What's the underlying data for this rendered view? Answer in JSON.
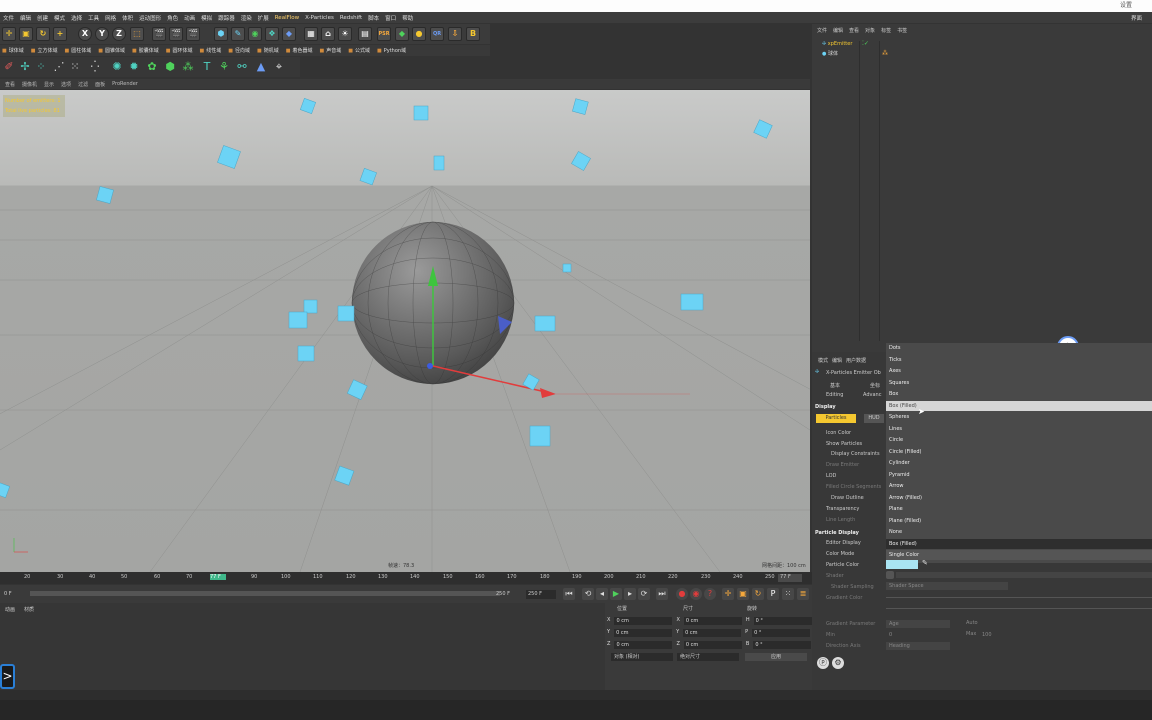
{
  "window": {
    "title": "设置"
  },
  "menubar": {
    "items": [
      "文件",
      "编辑",
      "创建",
      "模式",
      "选择",
      "工具",
      "网格",
      "体积",
      "运动图形",
      "角色",
      "动画",
      "模拟",
      "跟踪器",
      "渲染",
      "扩展",
      "窗口",
      "帮助"
    ],
    "highlight": "RealFlow",
    "extra": [
      "X-Particles",
      "Redshift",
      "脚本",
      "窗口",
      "帮助"
    ],
    "right": "界面"
  },
  "toolbar2": {
    "items": [
      "球体域",
      "立方体域",
      "圆柱体域",
      "圆锥体域",
      "胶囊体域",
      "圆环体域",
      "线性域",
      "径向域",
      "随机域",
      "着色器域",
      "声音域",
      "公式域",
      "Python域"
    ]
  },
  "viewport_menu": [
    "查看",
    "摄像机",
    "显示",
    "选项",
    "过滤",
    "面板",
    "ProRender"
  ],
  "hud": {
    "line1": "Number of emitters: 1",
    "line2": "Total live particles: 81"
  },
  "viewport_footer": {
    "speed": "帧速：78.3",
    "grid": "网格间距：100 cm"
  },
  "timeline": {
    "ticks": [
      "20",
      "30",
      "40",
      "50",
      "60",
      "70",
      "77 F",
      "90",
      "100",
      "110",
      "120",
      "130",
      "140",
      "150",
      "160",
      "170",
      "180",
      "190",
      "200",
      "210",
      "220",
      "230",
      "240",
      "250"
    ],
    "current_frame": "77 F",
    "end": "250 F"
  },
  "transport": {
    "start": "0 F",
    "end_field": "250 F",
    "end_field2": "250 F"
  },
  "bottom_left": {
    "tabs": [
      "动画",
      "材质"
    ]
  },
  "coords": {
    "headers": [
      "位置",
      "尺寸",
      "旋转"
    ],
    "rows": [
      {
        "axis": "X",
        "pos": "0 cm",
        "size_axis": "X",
        "size": "0 cm",
        "rot_axis": "H",
        "rot": "0 °"
      },
      {
        "axis": "Y",
        "pos": "0 cm",
        "size_axis": "Y",
        "size": "0 cm",
        "rot_axis": "P",
        "rot": "0 °"
      },
      {
        "axis": "Z",
        "pos": "0 cm",
        "size_axis": "Z",
        "size": "0 cm",
        "rot_axis": "B",
        "rot": "0 °"
      }
    ],
    "mode1": "对象 (相对)",
    "mode2": "绝对尺寸",
    "apply": "应用"
  },
  "object_manager": {
    "menu": [
      "文件",
      "编辑",
      "查看",
      "对象",
      "标签",
      "书签"
    ],
    "objects": [
      {
        "name": "xpEmitter",
        "color": "#f5c830"
      },
      {
        "name": "球体",
        "color": "#d8d8d8"
      }
    ]
  },
  "attributes": {
    "menu": [
      "模式",
      "编辑",
      "用户数据"
    ],
    "object_title": "X-Particles Emitter Ob",
    "tabs": [
      "基本",
      "坐标",
      "Editing",
      "Advanc"
    ],
    "section_display": "Display",
    "sub_tabs": [
      "Particles",
      "HUD"
    ],
    "rows": [
      {
        "label": "Icon Color",
        "dim": false
      },
      {
        "label": "Show Particles",
        "dim": false
      },
      {
        "label": "Display Constraints",
        "dim": false
      },
      {
        "label": "Draw Emitter",
        "dim": true
      },
      {
        "label": "LOD",
        "dim": false
      },
      {
        "label": "Filled Circle Segments",
        "dim": true
      },
      {
        "label": "Draw Outline",
        "dim": false
      },
      {
        "label": "Transparency",
        "dim": false
      },
      {
        "label": "Line Length",
        "dim": true
      }
    ],
    "section_particle": "Particle Display",
    "particle_rows": [
      {
        "label": "Editor Display",
        "value": "Box (Filled)"
      },
      {
        "label": "Color Mode",
        "value": "Single Color"
      },
      {
        "label": "Particle Color",
        "value": ""
      },
      {
        "label": "Shader",
        "value": ""
      },
      {
        "label": "Shader Sampling",
        "value": "Shader Space"
      },
      {
        "label": "Gradient Color",
        "value": ""
      },
      {
        "label": "Gradient Parameter",
        "value": "Age"
      },
      {
        "label": "Min",
        "value": "0"
      },
      {
        "label": "Direction Axis",
        "value": "Heading"
      }
    ],
    "auto_label": "Auto",
    "max_label": "Max",
    "max_value": "100",
    "particle_color_hex": "#a9e4f2"
  },
  "dropdown": {
    "items": [
      "Dots",
      "Ticks",
      "Axes",
      "Squares",
      "Box",
      "Box (Filled)",
      "Spheres",
      "Lines",
      "Circle",
      "Circle (Filled)",
      "Cylinder",
      "Pyramid",
      "Arrow",
      "Arrow (Filled)",
      "Plane",
      "Plane (Filled)",
      "None"
    ],
    "selected": "Box (Filled)"
  },
  "colors": {
    "accent": "#f5c830",
    "particle": "#6cd3f5",
    "background": "#333333"
  }
}
